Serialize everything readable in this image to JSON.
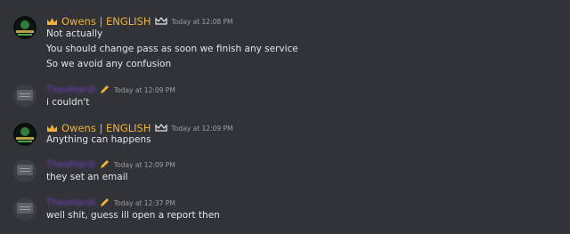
{
  "messages": [
    {
      "author": "Owens | ENGLISH",
      "timestamp": "Today at 12:08 PM",
      "lines": [
        "Not actually",
        "You should change pass as soon we finish any service",
        "So we avoid any confusion"
      ]
    },
    {
      "author": "TheoHardi",
      "timestamp": "Today at 12:09 PM",
      "lines": [
        "i couldn't"
      ]
    },
    {
      "author": "Owens | ENGLISH",
      "timestamp": "Today at 12:09 PM",
      "lines": [
        "Anything can happens"
      ]
    },
    {
      "author": "TheoHardi",
      "timestamp": "Today at 12:09 PM",
      "lines": [
        "they set an email"
      ]
    },
    {
      "author": "TheoHardi",
      "timestamp": "Today at 12:37 PM",
      "lines": [
        "well shit, guess ill open a report then"
      ]
    }
  ],
  "colors": {
    "owens_name": "#f0b232",
    "user_name": "#6f42c1",
    "background": "#313338"
  },
  "icons": {
    "crown": "crown-icon",
    "badge": "crown-badge-icon",
    "pencil": "pencil-icon"
  }
}
